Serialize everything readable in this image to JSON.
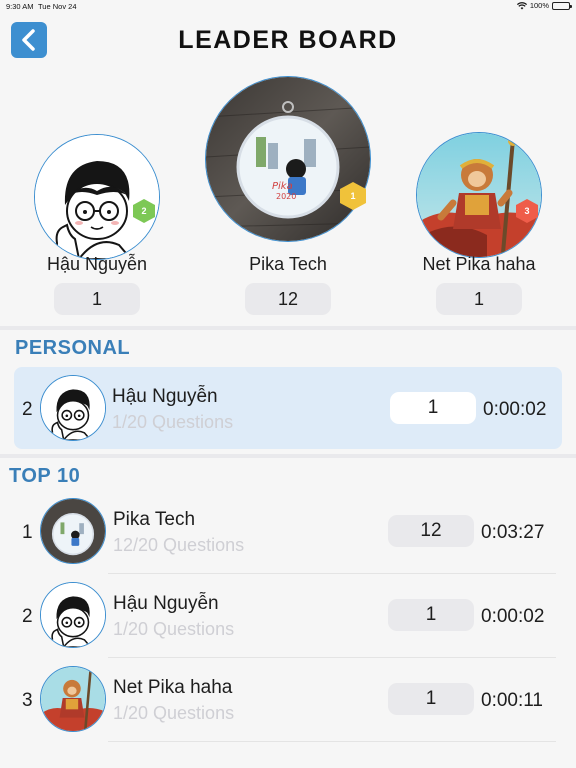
{
  "status_bar": {
    "time": "9:30 AM",
    "date": "Tue Nov 24",
    "battery": "100%"
  },
  "header": {
    "title": "LEADER BOARD",
    "back_icon": "chevron-left-icon",
    "accent": "#3d8fd0"
  },
  "podium": [
    {
      "name": "Hậu Nguyễn",
      "score": "1",
      "place": "2",
      "badge_color": "#7dc855",
      "avatar": "cartoon-boy-avatar"
    },
    {
      "name": "Pika Tech",
      "score": "12",
      "place": "1",
      "badge_color": "#f0c23a",
      "avatar": "keychain-photo-avatar"
    },
    {
      "name": "Net Pika haha",
      "score": "1",
      "place": "3",
      "badge_color": "#ef5d4a",
      "avatar": "monkey-king-avatar"
    }
  ],
  "personal": {
    "title": "PERSONAL",
    "rank": "2",
    "name": "Hậu Nguyễn",
    "questions": "1/20 Questions",
    "score": "1",
    "time": "0:00:02"
  },
  "top10": {
    "title": "TOP 10",
    "rows": [
      {
        "rank": "1",
        "name": "Pika Tech",
        "questions": "12/20 Questions",
        "score": "12",
        "time": "0:03:27",
        "avatar": "keychain-photo-avatar"
      },
      {
        "rank": "2",
        "name": "Hậu Nguyễn",
        "questions": "1/20 Questions",
        "score": "1",
        "time": "0:00:02",
        "avatar": "cartoon-boy-avatar"
      },
      {
        "rank": "3",
        "name": "Net Pika haha",
        "questions": "1/20 Questions",
        "score": "1",
        "time": "0:00:11",
        "avatar": "monkey-king-avatar"
      }
    ]
  }
}
